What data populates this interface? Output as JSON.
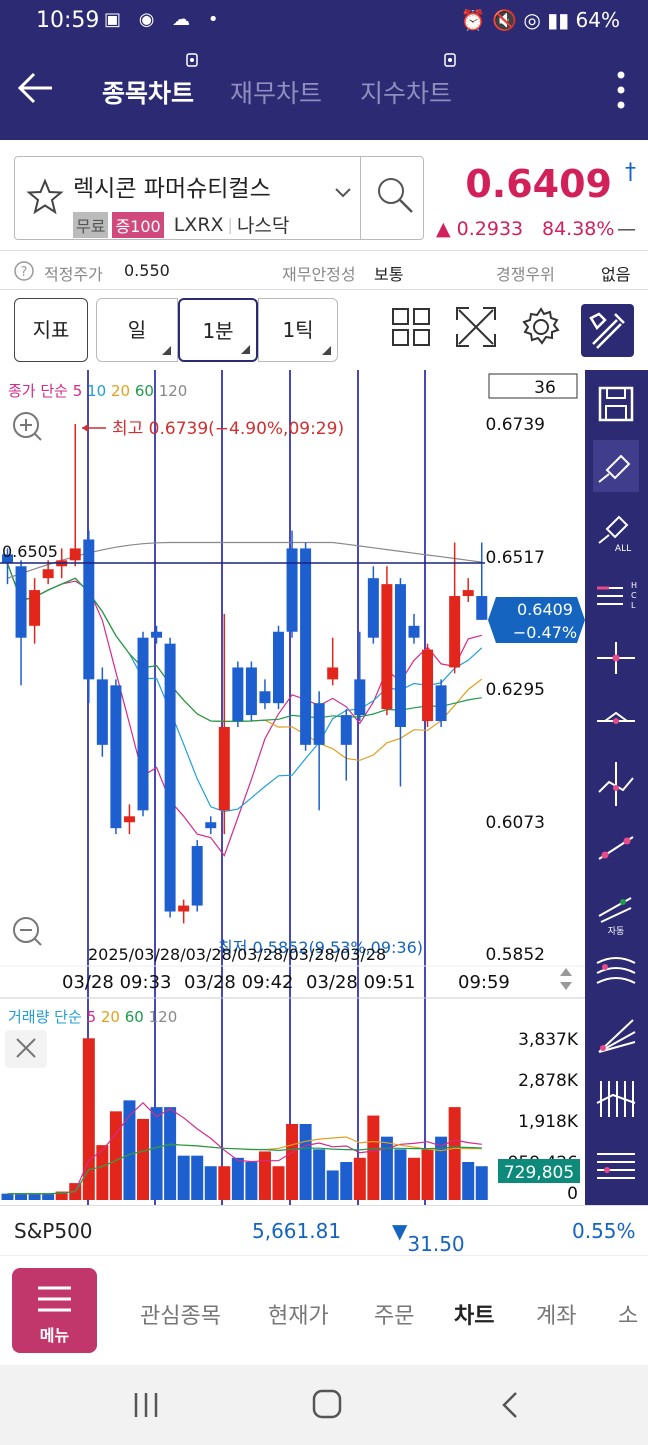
{
  "status": {
    "time": "10:59",
    "icons_left": "▣ ◉ ☁ •",
    "right_icons": "⏰ 🔇 ◎ ▮▮",
    "battery": "64%"
  },
  "appbar": {
    "tabs": [
      "종목차트",
      "재무차트",
      "지수차트"
    ],
    "active_tab": 0
  },
  "stock": {
    "name": "렉시콘 파머슈티컬스",
    "tag1": "무료",
    "tag2": "증100",
    "ticker": "LXRX",
    "market": "나스닥",
    "price": "0.6409",
    "change": "0.2933",
    "change_pct": "84.38%",
    "dash": "—",
    "dagger": "†"
  },
  "info": {
    "fair_label": "적정주가",
    "fair_value": "0.550",
    "stability_label": "재무안정성",
    "stability_value": "보통",
    "rank_label": "경쟁우위",
    "rank_value": "없음"
  },
  "toolbar": {
    "indicator": "지표",
    "day": "일",
    "min1": "1분",
    "tick1": "1틱"
  },
  "chart_data": {
    "type": "candlestick",
    "ma_legend": {
      "label": "종가 단순",
      "periods": [
        "5",
        "10",
        "20",
        "60",
        "120"
      ],
      "colors": [
        "#d62a8a",
        "#1f9fd8",
        "#e0a020",
        "#1e9b4c",
        "#888888"
      ]
    },
    "count_box": "36",
    "high_annotation": "최고 0.6739(−4.90%,09:29)",
    "low_annotation": "최저 0.5852(9.53%,09:36)",
    "left_price": "0.6505",
    "y_ticks": [
      "0.6739",
      "0.6517",
      "0.6295",
      "0.6073",
      "0.5852"
    ],
    "last_price": "0.6409",
    "last_pct": "−0.47%",
    "x_ticks": [
      "03/28 09:33",
      "03/28 09:42",
      "03/28 09:51",
      "09:59"
    ],
    "x_overlap_text": "2025/03/28/03/28/03/28/03/28/03/28",
    "ylim": [
      0.5852,
      0.6739
    ],
    "candles": [
      [
        0.652,
        0.6505,
        0.653,
        0.647
      ],
      [
        0.65,
        0.638,
        0.651,
        0.63
      ],
      [
        0.64,
        0.646,
        0.648,
        0.637
      ],
      [
        0.648,
        0.6495,
        0.651,
        0.647
      ],
      [
        0.65,
        0.651,
        0.653,
        0.648
      ],
      [
        0.651,
        0.653,
        0.6739,
        0.65
      ],
      [
        0.6545,
        0.631,
        0.656,
        0.627
      ],
      [
        0.631,
        0.62,
        0.633,
        0.618
      ],
      [
        0.63,
        0.606,
        0.631,
        0.605
      ],
      [
        0.607,
        0.608,
        0.61,
        0.605
      ],
      [
        0.638,
        0.609,
        0.639,
        0.608
      ],
      [
        0.639,
        0.638,
        0.64,
        0.637
      ],
      [
        0.637,
        0.592,
        0.638,
        0.591
      ],
      [
        0.592,
        0.593,
        0.594,
        0.59
      ],
      [
        0.603,
        0.593,
        0.604,
        0.592
      ],
      [
        0.607,
        0.606,
        0.608,
        0.605
      ],
      [
        0.609,
        0.623,
        0.642,
        0.605
      ],
      [
        0.633,
        0.624,
        0.634,
        0.623
      ],
      [
        0.633,
        0.625,
        0.634,
        0.624
      ],
      [
        0.629,
        0.627,
        0.631,
        0.626
      ],
      [
        0.639,
        0.627,
        0.64,
        0.626
      ],
      [
        0.653,
        0.639,
        0.656,
        0.638
      ],
      [
        0.653,
        0.62,
        0.654,
        0.619
      ],
      [
        0.627,
        0.62,
        0.629,
        0.609
      ],
      [
        0.631,
        0.633,
        0.638,
        0.63
      ],
      [
        0.625,
        0.62,
        0.626,
        0.614
      ],
      [
        0.631,
        0.625,
        0.639,
        0.624
      ],
      [
        0.648,
        0.638,
        0.65,
        0.637
      ],
      [
        0.626,
        0.647,
        0.65,
        0.625
      ],
      [
        0.647,
        0.623,
        0.648,
        0.613
      ],
      [
        0.64,
        0.638,
        0.642,
        0.637
      ],
      [
        0.624,
        0.636,
        0.637,
        0.623
      ],
      [
        0.63,
        0.624,
        0.631,
        0.623
      ],
      [
        0.633,
        0.645,
        0.654,
        0.632
      ],
      [
        0.645,
        0.646,
        0.648,
        0.644
      ],
      [
        0.645,
        0.641,
        0.654,
        0.641
      ]
    ],
    "vertical_lines_x": [
      88,
      155,
      222,
      290,
      358,
      425
    ],
    "volume": {
      "legend": {
        "label": "거래량 단순",
        "periods": [
          "5",
          "20",
          "60",
          "120"
        ],
        "colors": [
          "#d62a8a",
          "#e0a020",
          "#1e9b4c",
          "#888888"
        ]
      },
      "y_ticks": [
        "3,837K",
        "2,878K",
        "1,918K",
        "959,426",
        "0"
      ],
      "last_value": "729,805",
      "ylim": [
        0,
        3837
      ],
      "values": [
        150,
        150,
        150,
        150,
        200,
        400,
        3830,
        1300,
        2100,
        2360,
        1920,
        2200,
        2200,
        1050,
        1050,
        800,
        800,
        1000,
        900,
        1150,
        800,
        1800,
        1800,
        1200,
        700,
        900,
        1000,
        2000,
        1500,
        1200,
        1000,
        1200,
        1500,
        2200,
        900,
        800
      ],
      "colors": [
        "b",
        "b",
        "b",
        "b",
        "r",
        "r",
        "r",
        "r",
        "r",
        "b",
        "r",
        "b",
        "b",
        "b",
        "b",
        "b",
        "r",
        "b",
        "b",
        "r",
        "r",
        "r",
        "b",
        "b",
        "b",
        "b",
        "r",
        "r",
        "b",
        "b",
        "r",
        "r",
        "b",
        "r",
        "b",
        "b"
      ]
    }
  },
  "sp": {
    "label": "S&P500",
    "value": "5,661.81",
    "change": "31.50",
    "pct": "0.55%"
  },
  "nav": {
    "menu": "메뉴",
    "items": [
      "관심종목",
      "현재가",
      "주문",
      "차트",
      "계좌",
      "소"
    ],
    "active": 3
  }
}
